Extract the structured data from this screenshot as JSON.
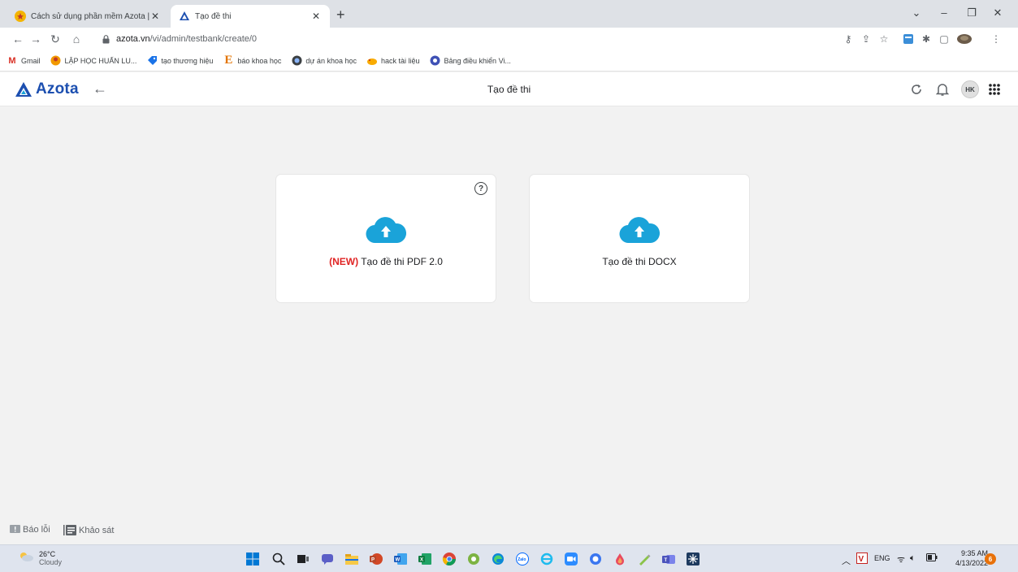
{
  "browser": {
    "tabs": [
      {
        "title": "Cách sử dụng phần mềm Azota |",
        "active": false
      },
      {
        "title": "Tạo đề thi",
        "active": true
      }
    ],
    "new_tab_symbol": "+",
    "url_domain": "azota.vn",
    "url_path": "/vi/admin/testbank/create/0",
    "bookmarks": [
      {
        "label": "Gmail",
        "icon": "gmail-icon"
      },
      {
        "label": "LẬP HỌC HUẤN LU...",
        "icon": "class-icon"
      },
      {
        "label": "tạo thương hiệu",
        "icon": "tag-icon"
      },
      {
        "label": "báo khoa học",
        "icon": "e-icon"
      },
      {
        "label": "dự án khoa học",
        "icon": "project-icon"
      },
      {
        "label": "hack tài liệu",
        "icon": "bird-icon"
      },
      {
        "label": "Bảng điều khiển Vi...",
        "icon": "dashboard-icon"
      }
    ]
  },
  "app": {
    "brand": "Azota",
    "page_title": "Tạo đề thi",
    "avatar_initials": "HK",
    "accent_color": "#1c4fb0",
    "cloud_color": "#1aa3d9"
  },
  "cards": [
    {
      "tag": "(NEW)",
      "label": " Tạo đề thi PDF 2.0",
      "has_help": true,
      "help_symbol": "?"
    },
    {
      "tag": "",
      "label": "Tạo đề thi DOCX",
      "has_help": false
    }
  ],
  "feedback": {
    "report_label": "Báo lỗi",
    "survey_label": "Khảo sát"
  },
  "taskbar": {
    "weather_temp": "26°C",
    "weather_desc": "Cloudy",
    "language": "ENG",
    "time": "9:35 AM",
    "date": "4/13/2022",
    "notification_count": "6"
  }
}
